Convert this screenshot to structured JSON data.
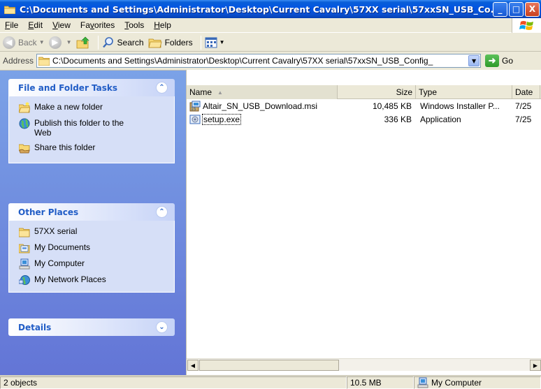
{
  "window": {
    "title": "C:\\Documents and Settings\\Administrator\\Desktop\\Current Cavalry\\57XX serial\\57xxSN_USB_Co...",
    "controls": [
      "_",
      "□",
      "X"
    ]
  },
  "menu": {
    "items": [
      {
        "first": "F",
        "rest": "ile"
      },
      {
        "first": "E",
        "rest": "dit"
      },
      {
        "first": "V",
        "rest": "iew"
      },
      {
        "first": "Fa",
        "u": "v",
        "rest": "orites"
      },
      {
        "first": "T",
        "rest": "ools"
      },
      {
        "first": "H",
        "rest": "elp"
      }
    ]
  },
  "toolbar": {
    "back_label": "Back",
    "search_label": "Search",
    "folders_label": "Folders"
  },
  "address": {
    "label": "Address",
    "value": "C:\\Documents and Settings\\Administrator\\Desktop\\Current Cavalry\\57XX serial\\57xxSN_USB_Config_",
    "go_label": "Go"
  },
  "tasks": {
    "file_folder": {
      "title": "File and Folder Tasks",
      "items": [
        "Make a new folder",
        "Publish this folder to the Web",
        "Share this folder"
      ]
    },
    "other_places": {
      "title": "Other Places",
      "items": [
        "57XX serial",
        "My Documents",
        "My Computer",
        "My Network Places"
      ]
    },
    "details": {
      "title": "Details"
    }
  },
  "columns": {
    "name": "Name",
    "size": "Size",
    "type": "Type",
    "date": "Date"
  },
  "files": [
    {
      "name": "Altair_SN_USB_Download.msi",
      "size": "10,485 KB",
      "type": "Windows Installer P...",
      "date": "7/25"
    },
    {
      "name": "setup.exe",
      "size": "336 KB",
      "type": "Application",
      "date": "7/25"
    }
  ],
  "status": {
    "objects": "2 objects",
    "size": "10.5 MB",
    "zone": "My Computer"
  }
}
